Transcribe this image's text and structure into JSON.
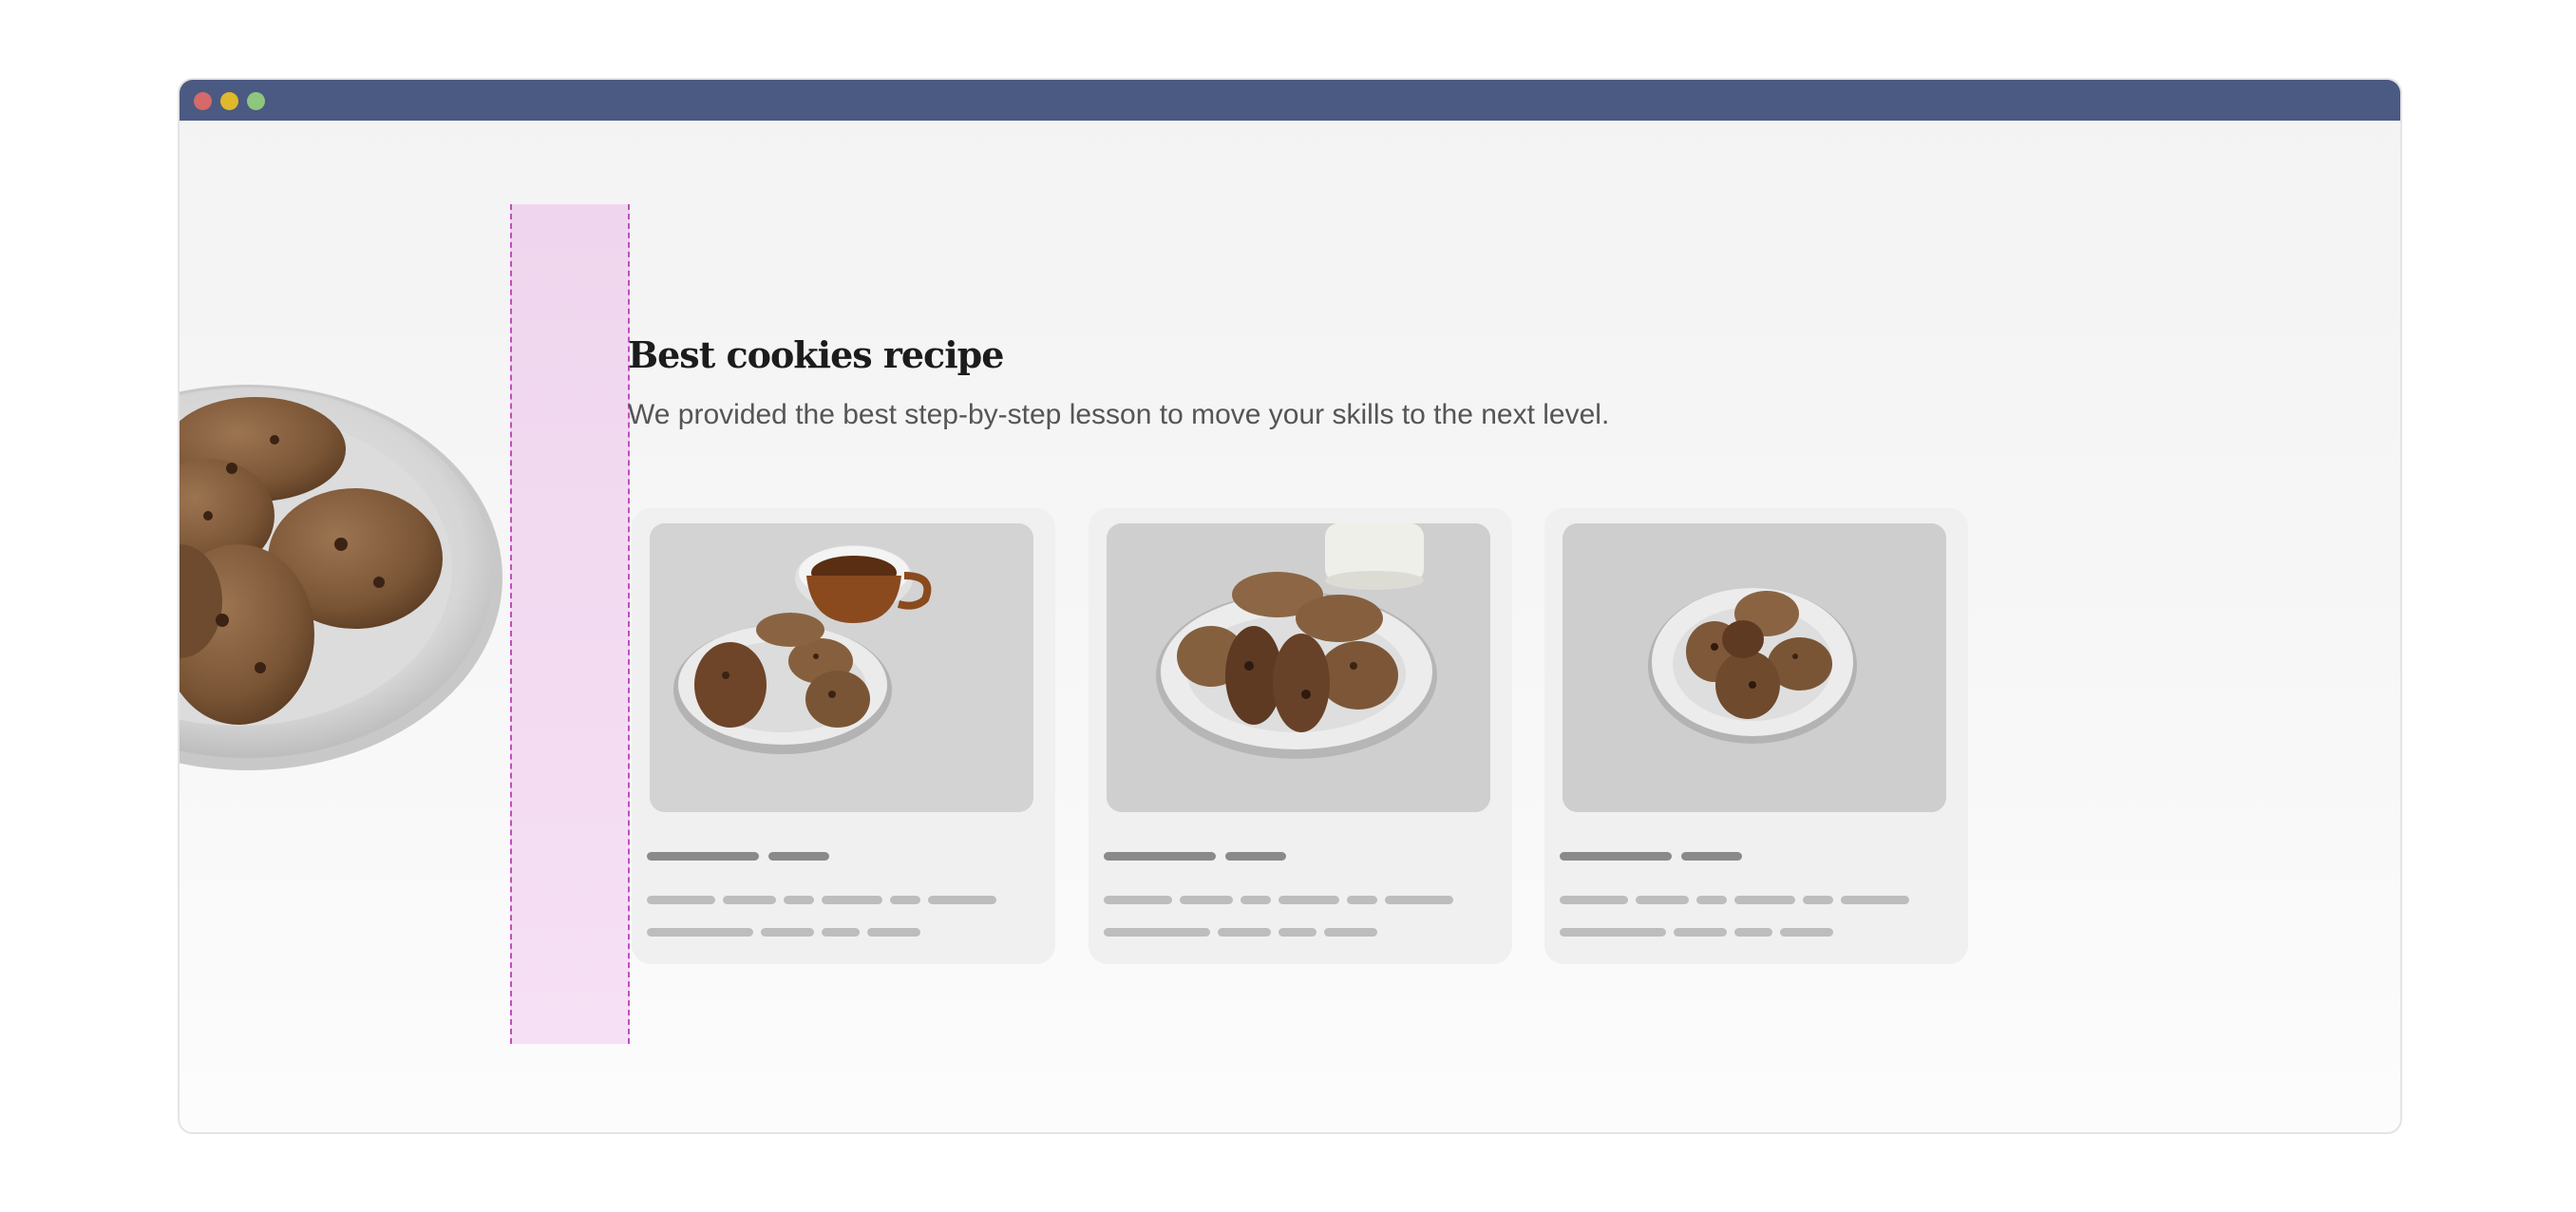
{
  "window": {
    "controls": [
      "close-dot",
      "minimize-dot",
      "maximize-dot"
    ],
    "titlebar_color": "#4b5a82"
  },
  "page": {
    "heading": "Best cookies recipe",
    "subtitle": "We provided the best step-by-step lesson to move your skills to the next level."
  },
  "cards": [
    {
      "image": "cookies-plate-with-coffee-photo"
    },
    {
      "image": "cookies-plate-with-milk-photo"
    },
    {
      "image": "cookies-plate-photo"
    }
  ],
  "colors": {
    "guide_fill": "#f2d9f1",
    "guide_border": "#c04fc0",
    "placeholder_dark": "#8a8a8a",
    "placeholder_light": "#bdbdbd",
    "card_background": "#f0f0f0"
  }
}
